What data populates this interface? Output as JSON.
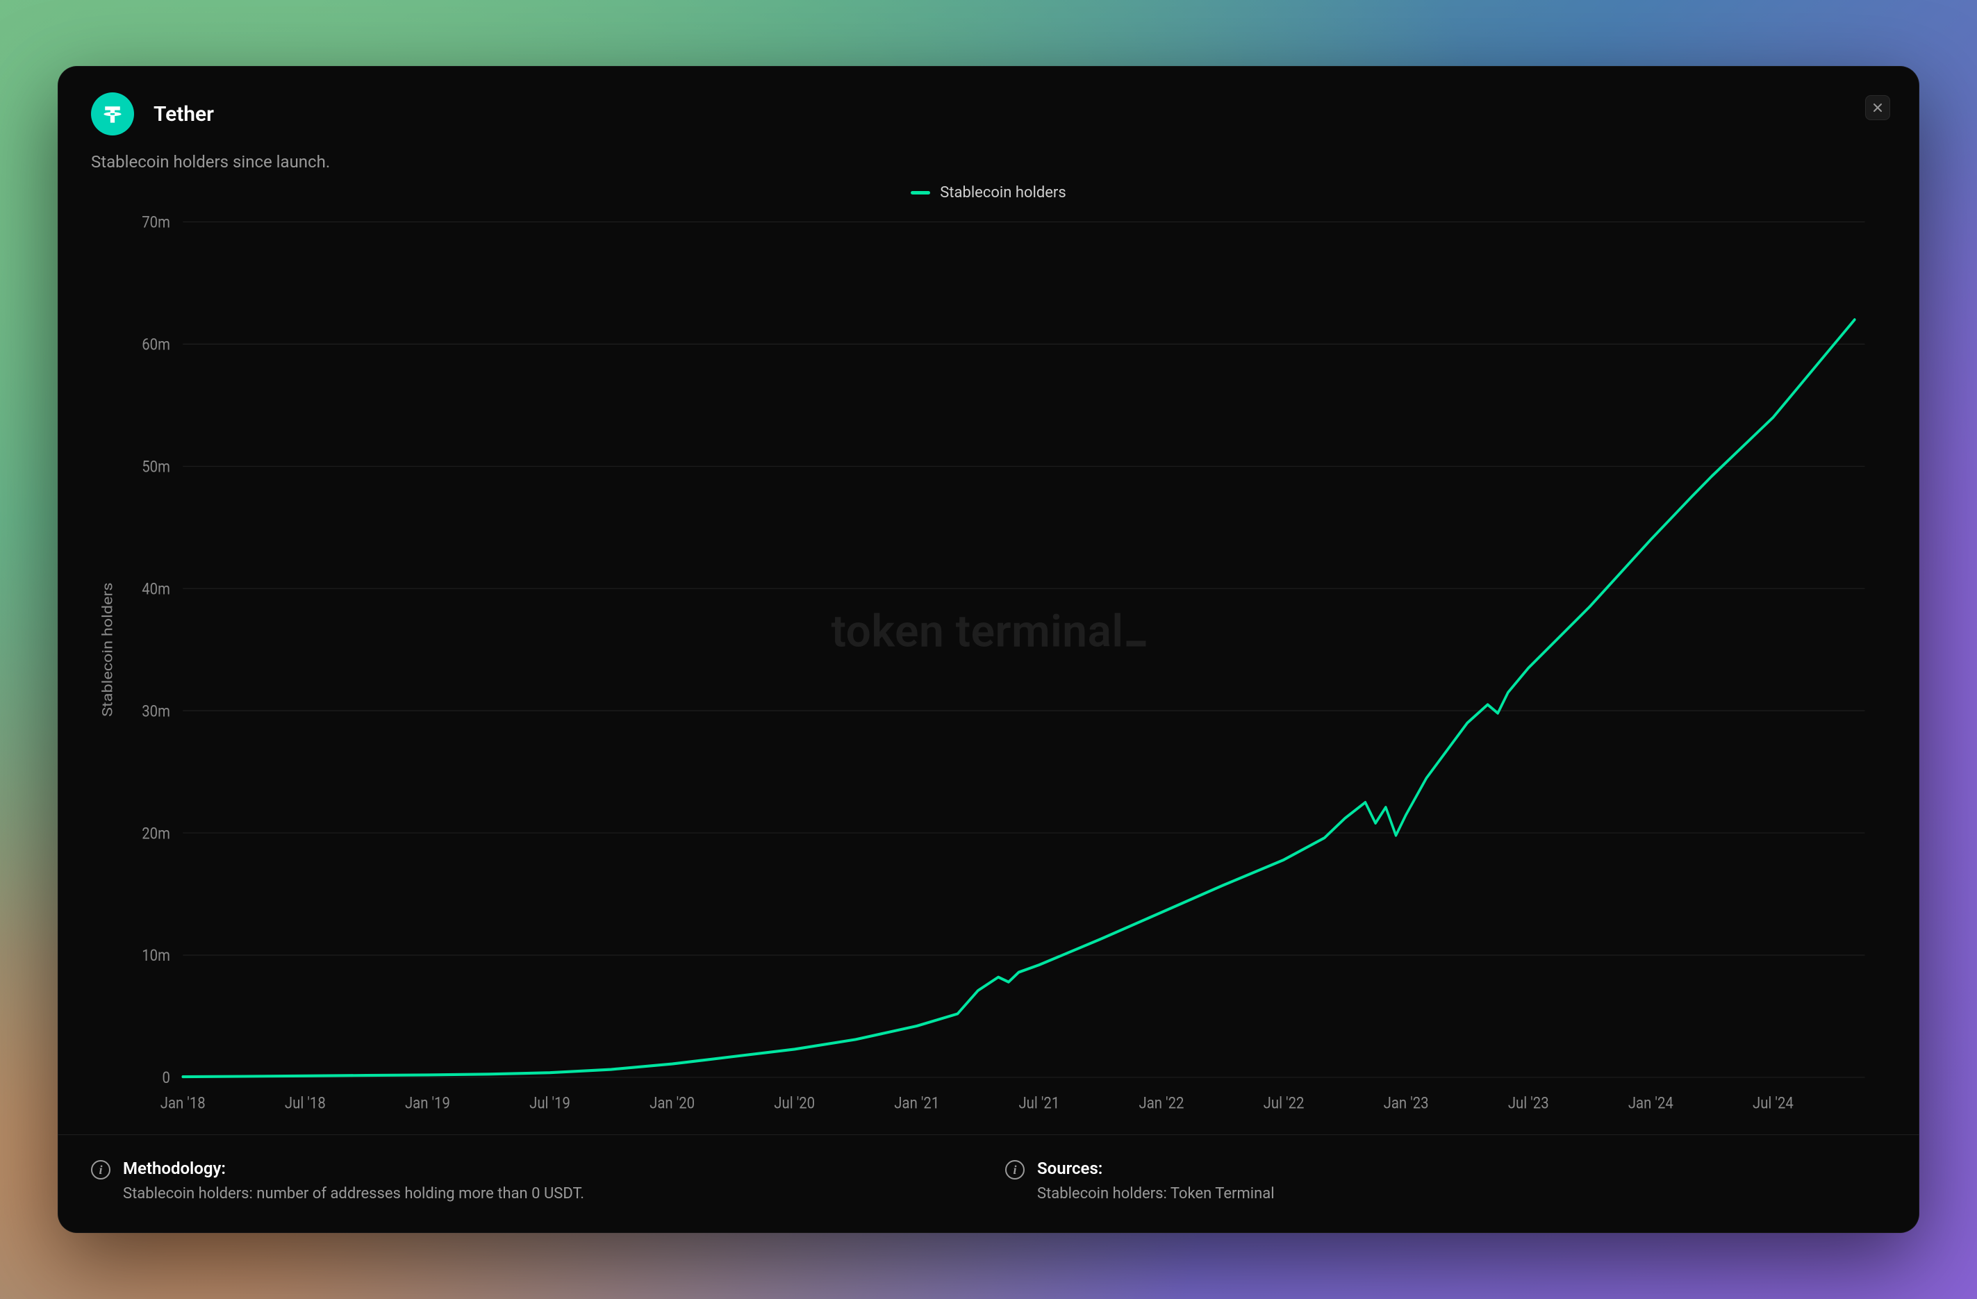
{
  "header": {
    "title": "Tether",
    "logo_name": "tether-logo"
  },
  "subtitle": "Stablecoin holders since launch.",
  "legend": {
    "series_label": "Stablecoin holders"
  },
  "watermark": "token terminal",
  "footer": {
    "methodology_label": "Methodology:",
    "methodology_text": "Stablecoin holders: number of addresses holding more than 0 USDT.",
    "sources_label": "Sources:",
    "sources_text": "Stablecoin holders: Token Terminal"
  },
  "colors": {
    "accent": "#00e6a1",
    "card_bg": "#0a0a0a",
    "text_primary": "#ffffff",
    "text_secondary": "#9a9a9a",
    "grid": "#1f1f1f"
  },
  "chart_data": {
    "type": "line",
    "title": "Stablecoin holders since launch.",
    "xlabel": "",
    "ylabel": "Stablecoin holders",
    "ylim": [
      0,
      70000000
    ],
    "y_ticks": [
      0,
      10000000,
      20000000,
      30000000,
      40000000,
      50000000,
      60000000,
      70000000
    ],
    "y_tick_labels": [
      "0",
      "10m",
      "20m",
      "30m",
      "40m",
      "50m",
      "60m",
      "70m"
    ],
    "x_tick_labels": [
      "Jan '18",
      "Jul '18",
      "Jan '19",
      "Jul '19",
      "Jan '20",
      "Jul '20",
      "Jan '21",
      "Jul '21",
      "Jan '22",
      "Jul '22",
      "Jan '23",
      "Jul '23",
      "Jan '24",
      "Jul '24"
    ],
    "series": [
      {
        "name": "Stablecoin holders",
        "color": "#00e6a1",
        "points": [
          {
            "x": "Jan '18",
            "y": 50000
          },
          {
            "x": "Apr '18",
            "y": 80000
          },
          {
            "x": "Jul '18",
            "y": 120000
          },
          {
            "x": "Oct '18",
            "y": 160000
          },
          {
            "x": "Jan '19",
            "y": 200000
          },
          {
            "x": "Apr '19",
            "y": 260000
          },
          {
            "x": "Jul '19",
            "y": 380000
          },
          {
            "x": "Oct '19",
            "y": 650000
          },
          {
            "x": "Jan '20",
            "y": 1100000
          },
          {
            "x": "Apr '20",
            "y": 1700000
          },
          {
            "x": "Jul '20",
            "y": 2300000
          },
          {
            "x": "Oct '20",
            "y": 3100000
          },
          {
            "x": "Jan '21",
            "y": 4200000
          },
          {
            "x": "Mar '21",
            "y": 5200000
          },
          {
            "x": "Apr '21",
            "y": 7100000
          },
          {
            "x": "May '21",
            "y": 8200000
          },
          {
            "x": "May '21 b",
            "y": 7800000
          },
          {
            "x": "Jun '21",
            "y": 8600000
          },
          {
            "x": "Jul '21",
            "y": 9200000
          },
          {
            "x": "Oct '21",
            "y": 11300000
          },
          {
            "x": "Jan '22",
            "y": 13500000
          },
          {
            "x": "Apr '22",
            "y": 15700000
          },
          {
            "x": "Jul '22",
            "y": 17800000
          },
          {
            "x": "Sep '22",
            "y": 19600000
          },
          {
            "x": "Oct '22",
            "y": 21200000
          },
          {
            "x": "Nov '22",
            "y": 22500000
          },
          {
            "x": "Nov '22 b",
            "y": 20800000
          },
          {
            "x": "Dec '22",
            "y": 22100000
          },
          {
            "x": "Dec '22 b",
            "y": 19800000
          },
          {
            "x": "Jan '23",
            "y": 21500000
          },
          {
            "x": "Feb '23",
            "y": 24500000
          },
          {
            "x": "Apr '23",
            "y": 29000000
          },
          {
            "x": "May '23",
            "y": 30500000
          },
          {
            "x": "May '23 b",
            "y": 29800000
          },
          {
            "x": "Jun '23",
            "y": 31500000
          },
          {
            "x": "Jul '23",
            "y": 33500000
          },
          {
            "x": "Oct '23",
            "y": 38500000
          },
          {
            "x": "Jan '24",
            "y": 44000000
          },
          {
            "x": "Mar '24",
            "y": 47500000
          },
          {
            "x": "Apr '24",
            "y": 49200000
          },
          {
            "x": "Jul '24",
            "y": 54000000
          },
          {
            "x": "Oct '24",
            "y": 60000000
          },
          {
            "x": "Nov '24",
            "y": 62000000
          }
        ]
      }
    ]
  }
}
